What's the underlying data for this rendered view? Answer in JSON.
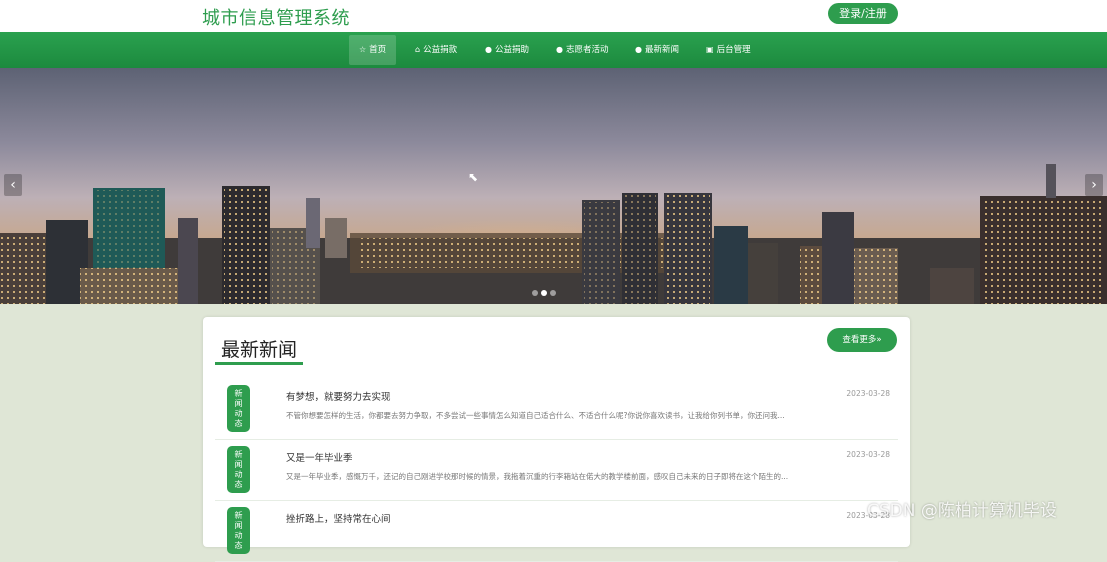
{
  "header": {
    "site_title": "城市信息管理系统",
    "login_label": "登录/注册"
  },
  "nav": {
    "items": [
      {
        "label": "首页",
        "icon": "star-icon"
      },
      {
        "label": "公益捐款",
        "icon": "home-icon"
      },
      {
        "label": "公益捐助",
        "icon": "info-icon"
      },
      {
        "label": "志愿者活动",
        "icon": "info-icon"
      },
      {
        "label": "最新新闻",
        "icon": "info-icon"
      },
      {
        "label": "后台管理",
        "icon": "briefcase-icon"
      }
    ],
    "active_index": 0
  },
  "banner": {
    "prev_label": "‹",
    "next_label": "›",
    "slide_count": 3,
    "active_slide": 1
  },
  "news": {
    "section_title": "最新新闻",
    "more_label": "查看更多»",
    "badge_text": "新闻动态",
    "items": [
      {
        "title": "有梦想，就要努力去实现",
        "date": "2023-03-28",
        "summary": "不管你想要怎样的生活，你都要去努力争取，不多尝试一些事情怎么知道自己适合什么、不适合什么呢?你说你喜欢读书，让我给你列书单，你还问我..."
      },
      {
        "title": "又是一年毕业季",
        "date": "2023-03-28",
        "summary": "又是一年毕业季，感慨万千，还记的自己刚进学校那时候的情景，我拖着沉重的行李箱站在偌大的教学楼前面，感叹自己未来的日子即将在这个陌生的..."
      },
      {
        "title": "挫折路上，坚持常在心间",
        "date": "2023-03-28",
        "summary": ""
      }
    ]
  },
  "watermark": "CSDN @陈柏计算机毕设",
  "colors": {
    "brand_green": "#2e9d4e",
    "nav_green": "#1c8a3e",
    "page_bg": "#dfe6d6"
  }
}
